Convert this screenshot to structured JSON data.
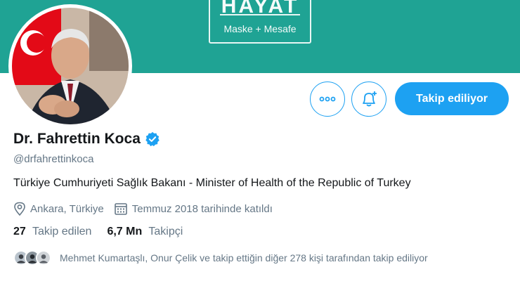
{
  "banner": {
    "title": "HAYAT",
    "subtitle": "Maske + Mesafe",
    "color": "#1fa394"
  },
  "profile": {
    "name": "Dr. Fahrettin Koca",
    "verified": true,
    "handle": "@drfahrettinkoca",
    "bio": "Türkiye Cumhuriyeti Sağlık Bakanı - Minister of Health of the Republic of Turkey",
    "location": "Ankara, Türkiye",
    "joined": "Temmuz 2018 tarihinde katıldı"
  },
  "actions": {
    "more_icon": "more-dots-icon",
    "notify_icon": "bell-plus-icon",
    "follow_label": "Takip ediliyor",
    "accent": "#1da1f2"
  },
  "stats": {
    "following_count": "27",
    "following_label": "Takip edilen",
    "followers_count": "6,7 Mn",
    "followers_label": "Takipçi"
  },
  "known_followers": {
    "text": "Mehmet Kumartaşlı, Onur Çelik ve takip ettiğin diğer 278 kişi tarafından takip ediliyor"
  }
}
